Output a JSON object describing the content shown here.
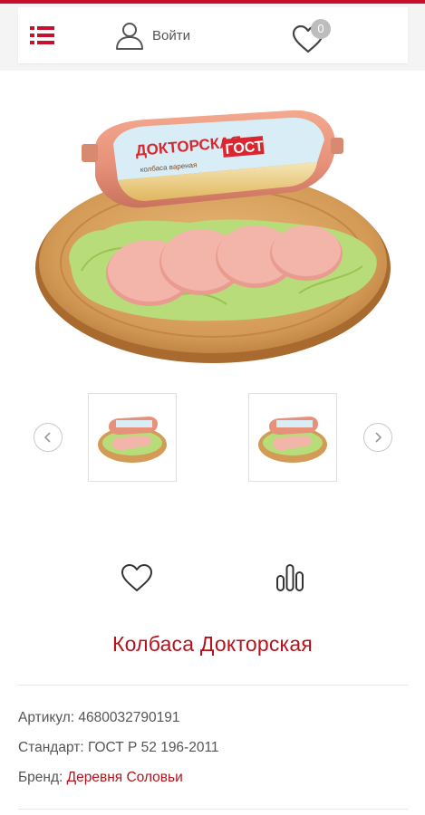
{
  "header": {
    "login_label": "Войти",
    "favorites_count": "0"
  },
  "product": {
    "title": "Колбаса Докторская",
    "package_text_1": "ДОКТОРСКАЯ",
    "package_text_2": "ГОСТ",
    "package_text_3": "колбаса вареная",
    "specs": [
      {
        "label": "Артикул:",
        "value": "4680032790191"
      },
      {
        "label": "Стандарт:",
        "value": "ГОСТ Р 52 196-2011"
      },
      {
        "label": "Бренд:",
        "value": "Деревня Соловьи"
      }
    ]
  },
  "icons": {
    "menu": "menu-icon",
    "user": "user-icon",
    "favorite": "heart-icon",
    "compare": "compare-icon",
    "prev": "chevron-left-icon",
    "next": "chevron-right-icon"
  },
  "colors": {
    "accent": "#c8102e",
    "title": "#b5121b",
    "badge": "#bdbdbd"
  }
}
